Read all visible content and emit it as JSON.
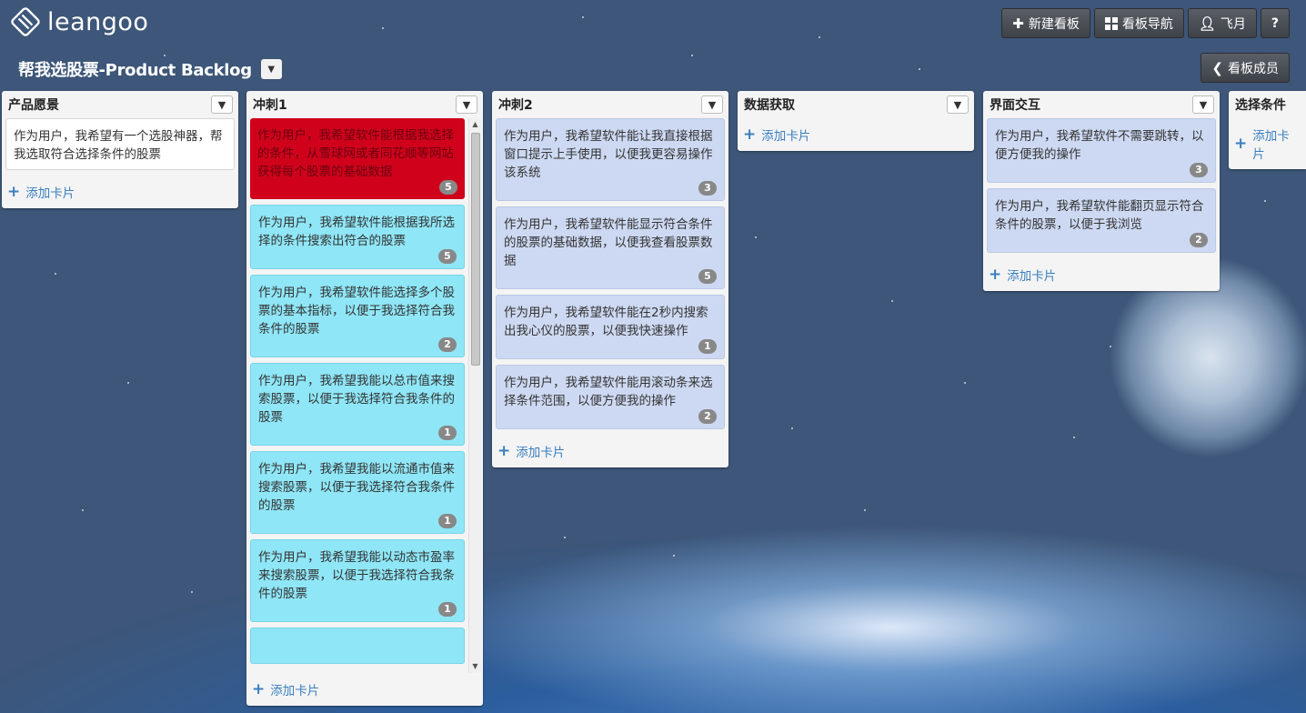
{
  "app": {
    "logo_text": "leangoo"
  },
  "topbar": {
    "new_board": "新建看板",
    "board_nav": "看板导航",
    "user": "飞月",
    "help": "?"
  },
  "board": {
    "title": "帮我选股票-Product Backlog",
    "members_button": "看板成员"
  },
  "add_card_label": "添加卡片",
  "lists": [
    {
      "title": "产品愿景",
      "cards": [
        {
          "text": "作为用户，我希望有一个选股神器，帮我选取符合选择条件的股票",
          "style": "white"
        }
      ]
    },
    {
      "title": "冲刺1",
      "cards": [
        {
          "text": "作为用户，我希望软件能根据我选择的条件，从雪球网或者同花顺等网站获得每个股票的基础数据",
          "badge": "5",
          "style": "red"
        },
        {
          "text": "作为用户，我希望软件能根据我所选择的条件搜索出符合的股票",
          "badge": "5",
          "style": "cyan"
        },
        {
          "text": "作为用户，我希望软件能选择多个股票的基本指标，以便于我选择符合我条件的股票",
          "badge": "2",
          "style": "cyan"
        },
        {
          "text": "作为用户，我希望我能以总市值来搜索股票，以便于我选择符合我条件的股票",
          "badge": "1",
          "style": "cyan"
        },
        {
          "text": "作为用户，我希望我能以流通市值来搜索股票，以便于我选择符合我条件的股票",
          "badge": "1",
          "style": "cyan"
        },
        {
          "text": "作为用户，我希望我能以动态市盈率来搜索股票，以便于我选择符合我条件的股票",
          "badge": "1",
          "style": "cyan"
        }
      ]
    },
    {
      "title": "冲刺2",
      "cards": [
        {
          "text": "作为用户，我希望软件能让我直接根据窗口提示上手使用，以便我更容易操作该系统",
          "badge": "3",
          "style": "lav"
        },
        {
          "text": "作为用户，我希望软件能显示符合条件的股票的基础数据，以便我查看股票数据",
          "badge": "5",
          "style": "lav"
        },
        {
          "text": "作为用户，我希望软件能在2秒内搜索出我心仪的股票，以便我快速操作",
          "badge": "1",
          "style": "lav"
        },
        {
          "text": "作为用户，我希望软件能用滚动条来选择条件范围，以便方便我的操作",
          "badge": "2",
          "style": "lav"
        }
      ]
    },
    {
      "title": "数据获取",
      "cards": []
    },
    {
      "title": "界面交互",
      "cards": [
        {
          "text": "作为用户，我希望软件不需要跳转，以便方便我的操作",
          "badge": "3",
          "style": "lav"
        },
        {
          "text": "作为用户，我希望软件能翻页显示符合条件的股票，以便于我浏览",
          "badge": "2",
          "style": "lav"
        }
      ]
    },
    {
      "title": "选择条件",
      "cards": []
    }
  ]
}
